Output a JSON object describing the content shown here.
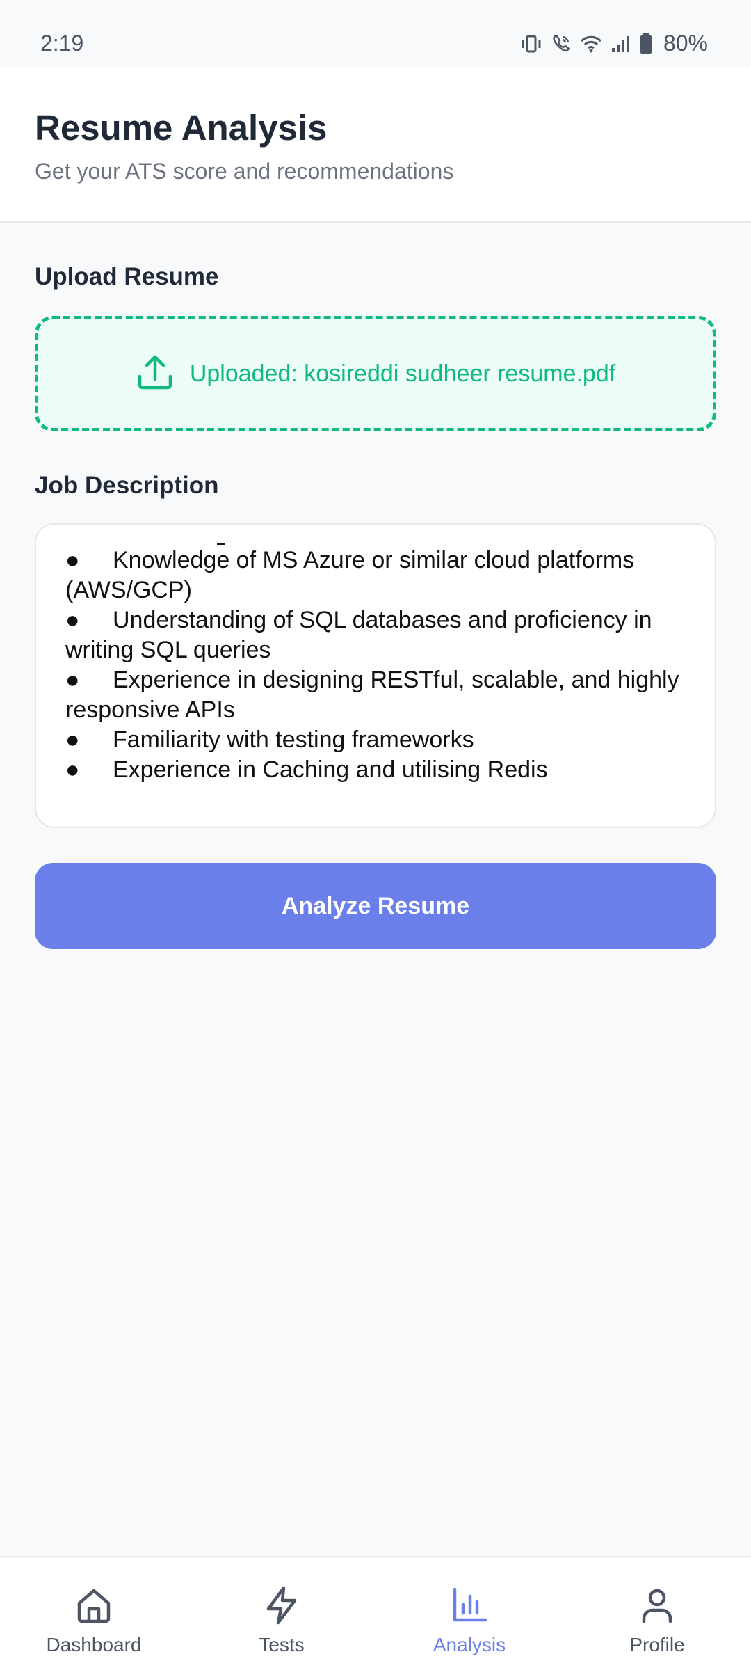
{
  "status_bar": {
    "time": "2:19",
    "battery": "80%",
    "icons": [
      "vibrate-icon",
      "wifi-call-icon",
      "wifi-icon",
      "signal-icon",
      "battery-icon"
    ]
  },
  "header": {
    "title": "Resume Analysis",
    "subtitle": "Get your ATS score and recommendations"
  },
  "upload": {
    "label": "Upload Resume",
    "status_text": "Uploaded: kosireddi sudheer resume.pdf",
    "icon": "upload-icon"
  },
  "job_description": {
    "label": "Job Description",
    "lines": [
      "●\tKnowledge of MS Azure or similar cloud platforms (AWS/GCP)",
      "●\tUnderstanding of SQL databases and proficiency in writing SQL queries",
      "●\tExperience in designing RESTful, scalable, and highly responsive APIs",
      "●\tFamiliarity with testing frameworks",
      "●\tExperience in Caching and utilising Redis"
    ]
  },
  "actions": {
    "analyze_label": "Analyze Resume"
  },
  "bottom_nav": {
    "items": [
      {
        "label": "Dashboard",
        "icon": "home-icon",
        "active": false
      },
      {
        "label": "Tests",
        "icon": "lightning-icon",
        "active": false
      },
      {
        "label": "Analysis",
        "icon": "bar-chart-icon",
        "active": true
      },
      {
        "label": "Profile",
        "icon": "user-icon",
        "active": false
      }
    ]
  },
  "colors": {
    "accent": "#6b7fea",
    "success": "#10b981",
    "success_bg": "#ecfdf5"
  }
}
